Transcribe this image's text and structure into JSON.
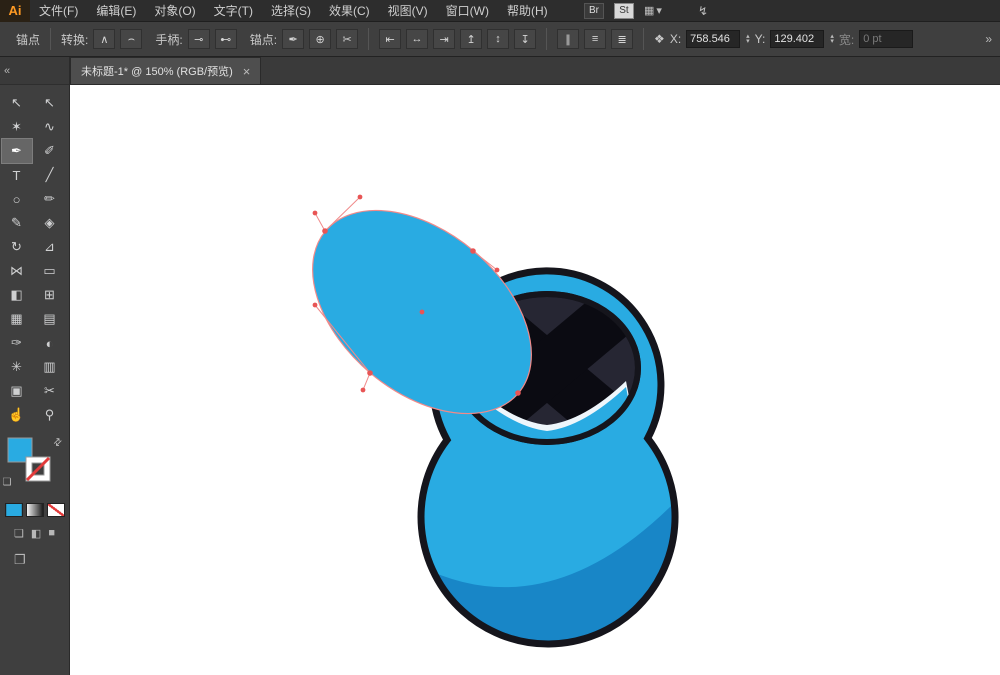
{
  "menubar": {
    "logo": "Ai",
    "items": [
      "文件(F)",
      "编辑(E)",
      "对象(O)",
      "文字(T)",
      "选择(S)",
      "效果(C)",
      "视图(V)",
      "窗口(W)",
      "帮助(H)"
    ],
    "br_button": "Br",
    "st_button": "St",
    "workspace_icon": "▦",
    "caret_icon": "▾",
    "power_icon": "↯"
  },
  "controlbar": {
    "tool_label": "锚点",
    "convert_label": "转换:",
    "convert_buttons": [
      "∧",
      "⌢"
    ],
    "handles_label": "手柄:",
    "handles_buttons": [
      "⊸",
      "⊷"
    ],
    "anchors_label": "锚点:",
    "anchors_buttons": [
      "✒",
      "⊕",
      "✂"
    ],
    "align_buttons": [
      "⇤",
      "↔",
      "⇥",
      "↥",
      "↕",
      "↧"
    ],
    "distribute_buttons": [
      "∥",
      "≡",
      "≣"
    ],
    "reference_icon": "❖",
    "x_label": "X:",
    "x_value": "758.546",
    "y_label": "Y:",
    "y_value": "129.402",
    "w_label": "宽:",
    "w_value": "0 pt",
    "stepper_up": "▴",
    "stepper_down": "▾",
    "end_icon": "»"
  },
  "tabbar": {
    "collapse_icon": "«",
    "tab_title": "未标题-1* @ 150% (RGB/预览)",
    "close_icon": "×"
  },
  "toolbar": {
    "tools": [
      "↖",
      "↖",
      "✶",
      "∿",
      "✒",
      "✐",
      "T",
      "╱",
      "○",
      "✏",
      "✎",
      "◈",
      "↻",
      "⊿",
      "⋈",
      "▭",
      "◧",
      "⊞",
      "▦",
      "▤",
      "✑",
      "◐",
      "✳",
      "▥",
      "▣",
      "✂",
      "☝",
      "⚲"
    ]
  },
  "swatches": {
    "fill_color": "#29abe2",
    "none_red": "#e23b3b",
    "swap_icon": "⇄",
    "default_icon": "❏",
    "screen_mode_icons": [
      "❏",
      "◧",
      "■"
    ],
    "draw_mode_icon": "❐"
  },
  "artwork": {
    "body_fill": "#29abe2",
    "body_shade": "#1886c7",
    "outline": "#15151c",
    "interior": "#262633",
    "x_mark": "#0b0b12",
    "rim_highlight": "#eef6fb",
    "anchor_color": "#e85555",
    "handle_color": "#f08a8a"
  }
}
